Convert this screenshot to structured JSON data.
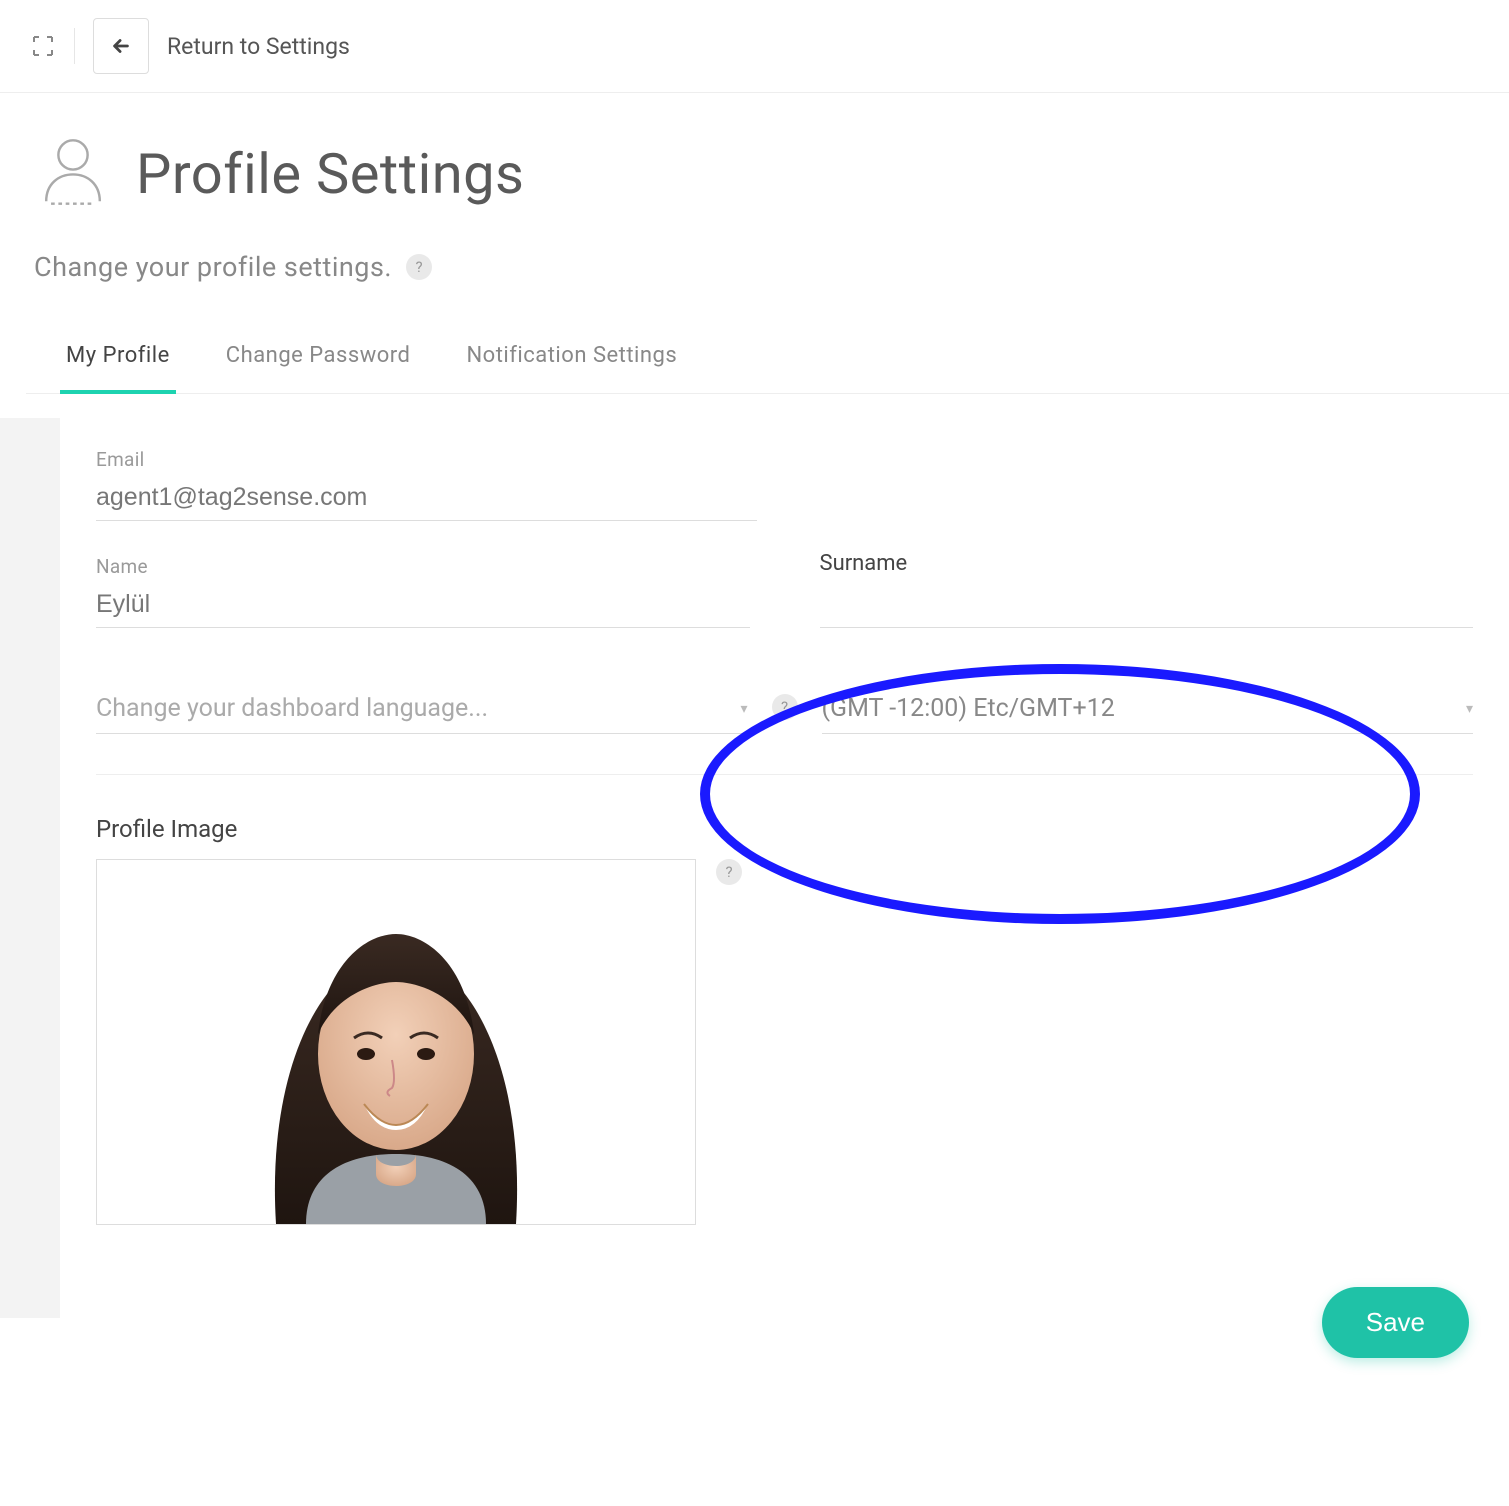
{
  "topbar": {
    "return_label": "Return to Settings"
  },
  "header": {
    "title": "Profile Settings",
    "subtitle": "Change your profile settings."
  },
  "tabs": [
    {
      "label": "My Profile",
      "active": true
    },
    {
      "label": "Change Password",
      "active": false
    },
    {
      "label": "Notification Settings",
      "active": false
    }
  ],
  "form": {
    "email_label": "Email",
    "email_value": "agent1@tag2sense.com",
    "name_label": "Name",
    "name_value": "Eylül",
    "surname_label": "Surname",
    "surname_value": "",
    "language_placeholder": "Change your dashboard language...",
    "timezone_value": "(GMT -12:00) Etc/GMT+12",
    "profile_image_label": "Profile Image",
    "save_label": "Save"
  },
  "help_glyph": "?"
}
